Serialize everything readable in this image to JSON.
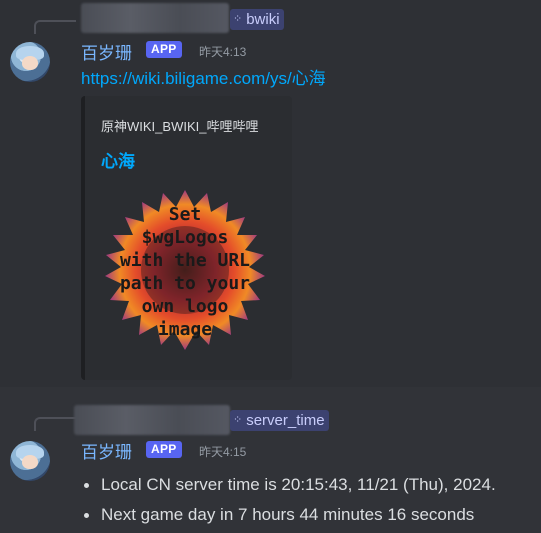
{
  "messages": [
    {
      "reply": {
        "command": "bwiki"
      },
      "author": {
        "name": "百岁珊",
        "badge": "APP",
        "timestamp": "昨天4:13"
      },
      "link": "https://wiki.biligame.com/ys/心海",
      "embed": {
        "provider": "原神WIKI_BWIKI_哔哩哔哩",
        "title": "心海",
        "image_text": [
          "Set",
          "$wgLogos",
          "with the URL",
          "path to your",
          "own logo",
          "image"
        ]
      }
    },
    {
      "reply": {
        "command": "server_time"
      },
      "author": {
        "name": "百岁珊",
        "badge": "APP",
        "timestamp": "昨天4:15"
      },
      "bullets": [
        "Local CN server time is 20:15:43, 11/21 (Thu), 2024.",
        "Next game day in 7 hours  44 minutes  16 seconds"
      ]
    }
  ],
  "icons": {
    "command": "slash-command-icon",
    "avatar": "bot-avatar"
  },
  "colors": {
    "background": "#313338",
    "highlight_background": "#2e3035",
    "username": "#7ab7ff",
    "link": "#00a8fc",
    "badge": "#5865f2",
    "command_chip": "#3c4270"
  }
}
